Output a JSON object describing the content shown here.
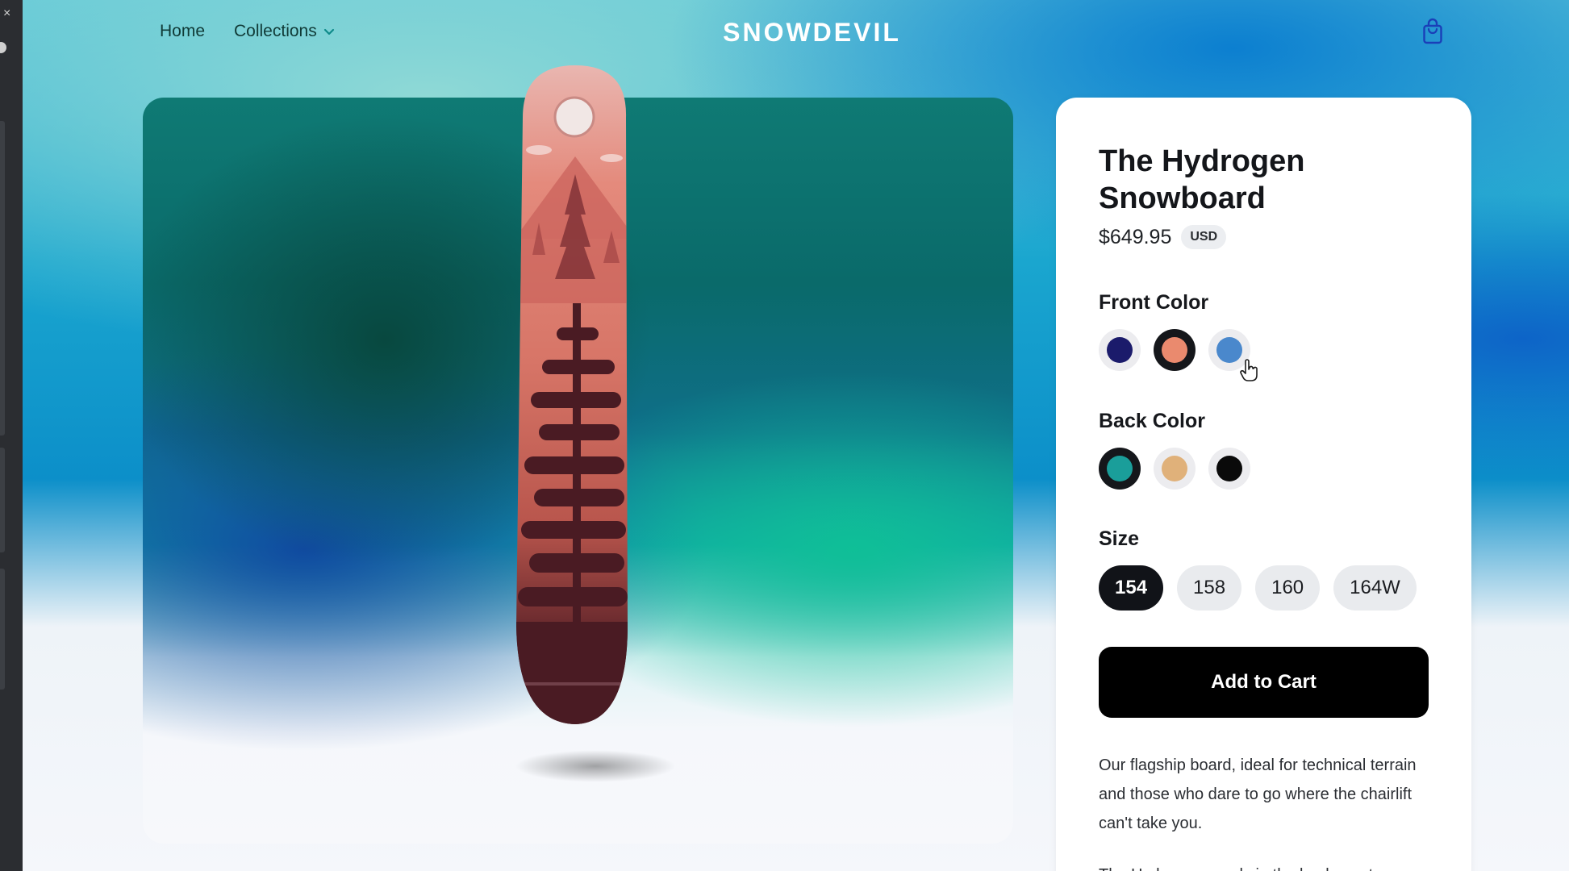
{
  "nav": {
    "home_label": "Home",
    "collections_label": "Collections",
    "brand": "SNOWDEVIL",
    "cart_icon": "shopping-bag-icon"
  },
  "product": {
    "title": "The Hydrogen Snowboard",
    "price": "$649.95",
    "currency": "USD",
    "front_color": {
      "label": "Front Color",
      "options": [
        {
          "color": "#1b1b6b",
          "selected": false
        },
        {
          "color": "#ea8a6e",
          "selected": true
        },
        {
          "color": "#4a88cc",
          "selected": false
        }
      ]
    },
    "back_color": {
      "label": "Back Color",
      "options": [
        {
          "color": "#1a9e9a",
          "selected": true
        },
        {
          "color": "#e0b17a",
          "selected": false
        },
        {
          "color": "#0a0a0a",
          "selected": false
        }
      ]
    },
    "size": {
      "label": "Size",
      "options": [
        {
          "value": "154",
          "selected": true
        },
        {
          "value": "158",
          "selected": false
        },
        {
          "value": "160",
          "selected": false
        },
        {
          "value": "164W",
          "selected": false
        }
      ]
    },
    "add_to_cart_label": "Add to Cart",
    "description": "Our flagship board, ideal for technical terrain and those who dare to go where the chairlift can't take you.",
    "description_cut": "The Hydrogen excels in the backcountry"
  },
  "colors": {
    "accent": "#0c8fc9",
    "card_bg": "#ffffff",
    "primary_button": "#000000"
  }
}
